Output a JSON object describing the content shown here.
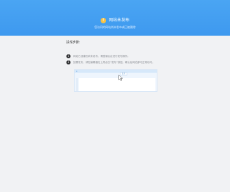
{
  "header": {
    "icon": "warning-icon",
    "icon_glyph": "!",
    "title": "网站未发布",
    "subtitle": "您访问的网站尚未发布或已被删除"
  },
  "steps": {
    "title": "操作步骤：",
    "items": [
      {
        "num": "1",
        "text": "网站已创建但尚未发布，请登录后台进行发布操作。"
      },
      {
        "num": "2",
        "text": "如需发布，请在编辑器右上角点击“发布”按钮，确认后网站即可正常访问。"
      }
    ]
  },
  "illustration": {
    "button_label": "发布"
  },
  "colors": {
    "header_bg": "#4aa5f3",
    "page_bg": "#f1f2f4",
    "accent": "#f7c244"
  }
}
